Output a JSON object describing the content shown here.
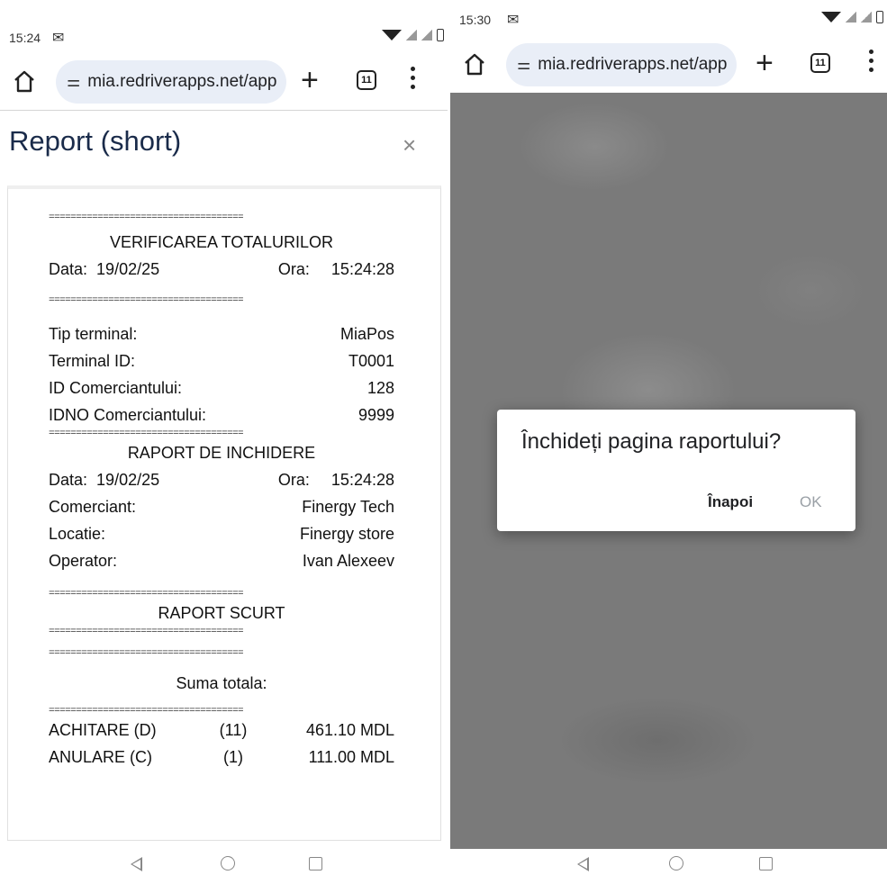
{
  "left": {
    "status": {
      "time": "15:24",
      "mail_icon": "gmail-icon"
    },
    "toolbar": {
      "url": "mia.redriverapps.net/app",
      "tabs_count": "11",
      "plus": "+"
    },
    "modal": {
      "title": "Report (short)",
      "close": "×"
    },
    "receipt": {
      "sep": "====================================",
      "title1": "VERIFICAREA TOTALURILOR",
      "date_label": "Data:",
      "date_value": "19/02/25",
      "time_label": "Ora:",
      "time_value": "15:24:28",
      "rows1": [
        {
          "label": "Tip terminal:",
          "value": "MiaPos"
        },
        {
          "label": "Terminal ID:",
          "value": "T0001"
        },
        {
          "label": "ID Comerciantului:",
          "value": "128"
        },
        {
          "label": "IDNO Comerciantului:",
          "value": "9999"
        }
      ],
      "title2": "RAPORT DE INCHIDERE",
      "rows2": [
        {
          "label": "Comerciant:",
          "value": "Finergy Tech"
        },
        {
          "label": "Locatie:",
          "value": "Finergy store"
        },
        {
          "label": "Operator:",
          "value": "Ivan Alexeev"
        }
      ],
      "title3": "RAPORT SCURT",
      "suma": "Suma totala:",
      "totals": [
        {
          "label": "ACHITARE (D)",
          "count": "(11)",
          "amount": "461.10 MDL"
        },
        {
          "label": "ANULARE (C)",
          "count": "(1)",
          "amount": "111.00 MDL"
        }
      ]
    }
  },
  "right": {
    "status": {
      "time": "15:30",
      "mail_icon": "gmail-icon"
    },
    "toolbar": {
      "url": "mia.redriverapps.net/app",
      "tabs_count": "11",
      "plus": "+"
    },
    "dialog": {
      "message": "Închideți pagina raportului?",
      "back_button": "Înapoi",
      "ok_button": "OK"
    }
  }
}
